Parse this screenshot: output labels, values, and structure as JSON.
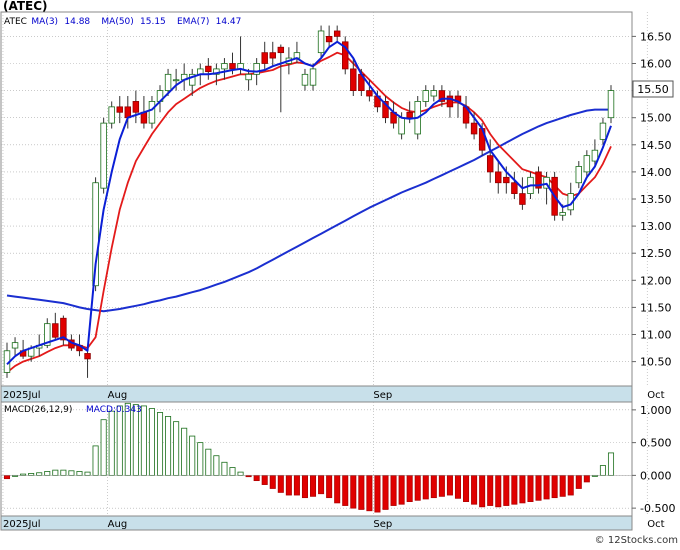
{
  "chart_data": {
    "type": "candlestick",
    "symbol": "(ATEC)",
    "watermark": "© 12Stocks.com",
    "legend": [
      {
        "label": "ATEC",
        "value": "",
        "color": "#000000"
      },
      {
        "label": "MA(3)",
        "value": "14.88",
        "color": "#0000cc"
      },
      {
        "label": "MA(50)",
        "value": "15.15",
        "color": "#0000cc"
      },
      {
        "label": "EMA(7)",
        "value": "14.47",
        "color": "#0000cc"
      }
    ],
    "last_price": "15.50",
    "price_ylim": [
      10.05,
      16.95
    ],
    "price_ticks": [
      "16.50",
      "16.00",
      "15.50",
      "15.00",
      "14.50",
      "14.00",
      "13.50",
      "13.00",
      "12.50",
      "12.00",
      "11.50",
      "11.00",
      "10.50"
    ],
    "x_labels": [
      {
        "label": "2025Jul",
        "index": 0
      },
      {
        "label": "Aug",
        "index": 13
      },
      {
        "label": "Sep",
        "index": 46
      },
      {
        "label": "Oct",
        "index": 80
      }
    ],
    "candles": [
      [
        10.3,
        10.85,
        10.2,
        10.7
      ],
      [
        10.75,
        10.95,
        10.6,
        10.85
      ],
      [
        10.7,
        10.9,
        10.55,
        10.6
      ],
      [
        10.6,
        10.8,
        10.5,
        10.75
      ],
      [
        10.75,
        11.0,
        10.6,
        10.8
      ],
      [
        10.8,
        11.3,
        10.75,
        11.2
      ],
      [
        11.2,
        11.4,
        10.9,
        10.95
      ],
      [
        11.3,
        11.35,
        10.8,
        10.9
      ],
      [
        10.9,
        11.0,
        10.7,
        10.75
      ],
      [
        10.8,
        11.0,
        10.6,
        10.7
      ],
      [
        10.65,
        10.75,
        10.2,
        10.55
      ],
      [
        11.9,
        13.9,
        11.8,
        13.8
      ],
      [
        13.7,
        15.0,
        13.6,
        14.9
      ],
      [
        14.9,
        15.3,
        14.8,
        15.2
      ],
      [
        15.2,
        15.4,
        14.9,
        15.1
      ],
      [
        15.2,
        15.4,
        14.8,
        15.0
      ],
      [
        15.3,
        15.5,
        14.9,
        15.1
      ],
      [
        15.1,
        15.4,
        14.8,
        14.9
      ],
      [
        14.9,
        15.4,
        14.8,
        15.3
      ],
      [
        15.3,
        15.6,
        15.1,
        15.5
      ],
      [
        15.5,
        15.9,
        15.4,
        15.8
      ],
      [
        15.7,
        15.9,
        15.5,
        15.7
      ],
      [
        15.7,
        16.0,
        15.5,
        15.8
      ],
      [
        15.6,
        15.9,
        15.4,
        15.8
      ],
      [
        15.8,
        16.0,
        15.6,
        15.9
      ],
      [
        15.95,
        16.1,
        15.7,
        15.85
      ],
      [
        15.8,
        16.0,
        15.6,
        15.9
      ],
      [
        15.9,
        16.1,
        15.7,
        16.0
      ],
      [
        16.0,
        16.2,
        15.8,
        15.9
      ],
      [
        15.9,
        16.5,
        15.8,
        16.0
      ],
      [
        15.7,
        15.9,
        15.5,
        15.8
      ],
      [
        15.8,
        16.1,
        15.6,
        16.0
      ],
      [
        16.2,
        16.4,
        15.9,
        16.0
      ],
      [
        16.2,
        16.4,
        15.95,
        16.1
      ],
      [
        16.3,
        16.35,
        15.1,
        16.2
      ],
      [
        16.0,
        16.3,
        15.8,
        16.1
      ],
      [
        16.1,
        16.4,
        16.0,
        16.2
      ],
      [
        15.6,
        15.9,
        15.5,
        15.8
      ],
      [
        15.6,
        16.0,
        15.5,
        15.9
      ],
      [
        16.2,
        16.7,
        16.1,
        16.6
      ],
      [
        16.5,
        16.7,
        16.3,
        16.4
      ],
      [
        16.6,
        16.7,
        16.4,
        16.5
      ],
      [
        16.4,
        16.5,
        15.8,
        15.9
      ],
      [
        15.9,
        16.1,
        15.4,
        15.5
      ],
      [
        15.8,
        15.9,
        15.4,
        15.5
      ],
      [
        15.5,
        15.7,
        15.3,
        15.4
      ],
      [
        15.4,
        15.5,
        15.1,
        15.2
      ],
      [
        15.3,
        15.4,
        14.9,
        15.0
      ],
      [
        15.1,
        15.3,
        14.8,
        14.9
      ],
      [
        14.7,
        15.1,
        14.6,
        15.0
      ],
      [
        15.1,
        15.3,
        14.9,
        15.0
      ],
      [
        14.7,
        15.4,
        14.6,
        15.3
      ],
      [
        15.3,
        15.6,
        15.2,
        15.5
      ],
      [
        15.4,
        15.6,
        15.3,
        15.5
      ],
      [
        15.5,
        15.6,
        15.2,
        15.3
      ],
      [
        15.4,
        15.5,
        15.0,
        15.2
      ],
      [
        15.4,
        15.5,
        15.0,
        15.3
      ],
      [
        15.2,
        15.4,
        14.8,
        14.9
      ],
      [
        14.9,
        15.1,
        14.6,
        14.7
      ],
      [
        14.8,
        14.9,
        14.3,
        14.4
      ],
      [
        14.3,
        14.6,
        13.8,
        14.0
      ],
      [
        14.0,
        14.2,
        13.6,
        13.8
      ],
      [
        13.9,
        14.1,
        13.6,
        13.8
      ],
      [
        13.8,
        14.0,
        13.5,
        13.6
      ],
      [
        13.6,
        13.9,
        13.3,
        13.4
      ],
      [
        13.6,
        14.0,
        13.5,
        13.9
      ],
      [
        14.0,
        14.1,
        13.6,
        13.7
      ],
      [
        13.7,
        14.0,
        13.4,
        13.9
      ],
      [
        13.9,
        14.0,
        13.1,
        13.2
      ],
      [
        13.2,
        13.4,
        13.1,
        13.25
      ],
      [
        13.3,
        13.8,
        13.2,
        13.6
      ],
      [
        13.8,
        14.2,
        13.7,
        14.1
      ],
      [
        14.0,
        14.4,
        13.9,
        14.3
      ],
      [
        14.2,
        14.6,
        14.1,
        14.4
      ],
      [
        14.6,
        15.0,
        14.5,
        14.9
      ],
      [
        15.0,
        15.6,
        14.9,
        15.5
      ]
    ],
    "ma3": [
      10.45,
      10.6,
      10.7,
      10.75,
      10.8,
      10.85,
      10.9,
      10.95,
      10.85,
      10.8,
      10.7,
      12.3,
      13.3,
      14.0,
      14.6,
      15.0,
      15.05,
      15.1,
      15.15,
      15.3,
      15.45,
      15.6,
      15.7,
      15.75,
      15.8,
      15.8,
      15.82,
      15.85,
      15.88,
      15.9,
      15.86,
      15.85,
      15.88,
      15.95,
      16.0,
      16.05,
      16.1,
      16.0,
      15.95,
      16.1,
      16.3,
      16.4,
      16.3,
      16.1,
      15.8,
      15.6,
      15.4,
      15.25,
      15.1,
      15.0,
      14.98,
      15.0,
      15.1,
      15.25,
      15.35,
      15.35,
      15.3,
      15.2,
      15.0,
      14.8,
      14.4,
      14.2,
      14.0,
      13.85,
      13.7,
      13.75,
      13.75,
      13.78,
      13.55,
      13.35,
      13.4,
      13.6,
      13.9,
      14.1,
      14.45,
      14.85
    ],
    "ema7": [
      10.3,
      10.42,
      10.5,
      10.55,
      10.6,
      10.68,
      10.75,
      10.8,
      10.8,
      10.8,
      10.75,
      10.95,
      11.8,
      12.6,
      13.3,
      13.8,
      14.2,
      14.45,
      14.7,
      14.9,
      15.1,
      15.25,
      15.35,
      15.45,
      15.55,
      15.62,
      15.68,
      15.72,
      15.76,
      15.8,
      15.8,
      15.82,
      15.85,
      15.88,
      15.95,
      15.98,
      16.02,
      16.0,
      15.95,
      16.05,
      16.12,
      16.2,
      16.15,
      16.0,
      15.85,
      15.7,
      15.55,
      15.4,
      15.28,
      15.18,
      15.12,
      15.1,
      15.14,
      15.2,
      15.25,
      15.28,
      15.28,
      15.22,
      15.1,
      14.95,
      14.7,
      14.5,
      14.35,
      14.2,
      14.05,
      14.0,
      13.95,
      13.9,
      13.75,
      13.6,
      13.55,
      13.6,
      13.75,
      13.9,
      14.15,
      14.47
    ],
    "ma50": [
      11.72,
      11.7,
      11.68,
      11.66,
      11.64,
      11.62,
      11.6,
      11.58,
      11.54,
      11.5,
      11.47,
      11.45,
      11.43,
      11.45,
      11.47,
      11.5,
      11.53,
      11.56,
      11.6,
      11.63,
      11.67,
      11.7,
      11.74,
      11.78,
      11.82,
      11.87,
      11.92,
      11.97,
      12.03,
      12.09,
      12.15,
      12.22,
      12.3,
      12.38,
      12.46,
      12.54,
      12.62,
      12.7,
      12.78,
      12.86,
      12.94,
      13.02,
      13.1,
      13.18,
      13.26,
      13.34,
      13.41,
      13.48,
      13.55,
      13.62,
      13.68,
      13.74,
      13.8,
      13.87,
      13.94,
      14.01,
      14.08,
      14.15,
      14.22,
      14.3,
      14.38,
      14.46,
      14.54,
      14.62,
      14.7,
      14.77,
      14.84,
      14.9,
      14.95,
      15.0,
      15.05,
      15.09,
      15.13,
      15.15,
      15.15,
      15.15
    ],
    "macd_label": "MACD(26,12,9)",
    "macd_value_label": "MACD:0.343",
    "macd_ylim": [
      -0.62,
      1.12
    ],
    "macd_ticks": [
      "1.000",
      "0.500",
      "0.000",
      "-0.500"
    ],
    "macd": [
      -0.05,
      0.0,
      0.02,
      0.03,
      0.04,
      0.06,
      0.08,
      0.08,
      0.07,
      0.06,
      0.05,
      0.45,
      0.85,
      0.98,
      1.06,
      1.1,
      1.08,
      1.06,
      1.02,
      0.96,
      0.9,
      0.82,
      0.72,
      0.6,
      0.5,
      0.4,
      0.3,
      0.2,
      0.12,
      0.05,
      -0.02,
      -0.08,
      -0.14,
      -0.2,
      -0.26,
      -0.3,
      -0.3,
      -0.34,
      -0.32,
      -0.28,
      -0.34,
      -0.42,
      -0.46,
      -0.5,
      -0.52,
      -0.54,
      -0.56,
      -0.52,
      -0.46,
      -0.44,
      -0.4,
      -0.38,
      -0.36,
      -0.34,
      -0.32,
      -0.3,
      -0.35,
      -0.4,
      -0.44,
      -0.48,
      -0.46,
      -0.48,
      -0.46,
      -0.44,
      -0.42,
      -0.4,
      -0.38,
      -0.36,
      -0.34,
      -0.32,
      -0.3,
      -0.2,
      -0.1,
      0.0,
      0.15,
      0.343
    ]
  }
}
